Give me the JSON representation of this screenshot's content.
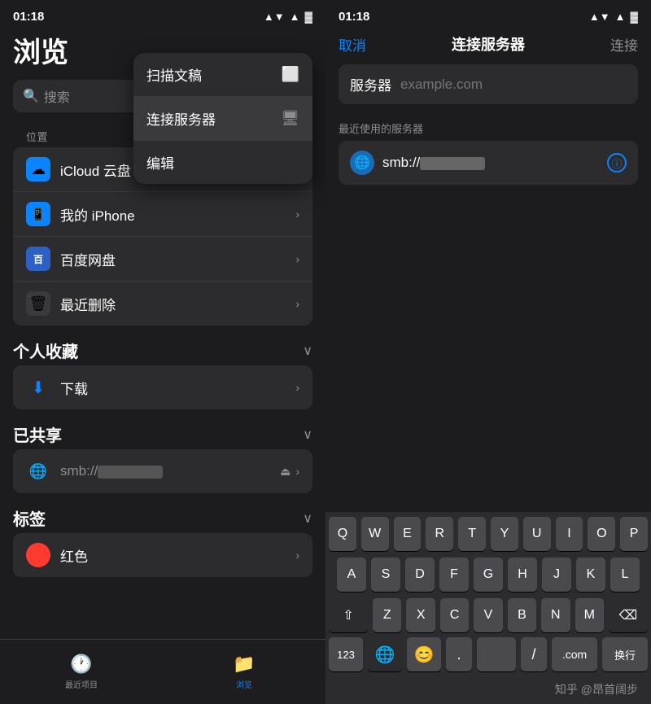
{
  "left": {
    "statusBar": {
      "time": "01:18",
      "icons": "▲ ▼ ● ■"
    },
    "title": "浏览",
    "moreBtn": "•••",
    "searchPlaceholder": "搜索",
    "locationLabel": "位置",
    "locationItems": [
      {
        "id": "icloud",
        "label": "iCloud 云盘",
        "iconColor": "#1a9af5",
        "iconEmoji": "☁"
      },
      {
        "id": "iphone",
        "label": "我的 iPhone",
        "iconColor": "#0a84ff",
        "iconEmoji": "📱"
      },
      {
        "id": "baidu",
        "label": "百度网盘",
        "iconColor": "#2d60c4",
        "iconEmoji": "🅱"
      },
      {
        "id": "trash",
        "label": "最近删除",
        "iconColor": "#3a3a3c",
        "iconEmoji": "🗑"
      }
    ],
    "favoritesLabel": "个人收藏",
    "favoritesItems": [
      {
        "id": "download",
        "label": "下载"
      }
    ],
    "sharedLabel": "已共享",
    "sharedItems": [
      {
        "id": "shared-smb",
        "label": "smb://[redacted]"
      }
    ],
    "tagsLabel": "标签",
    "tagsItems": [
      {
        "id": "red-tag",
        "label": "红色",
        "color": "#ff3b30"
      }
    ],
    "nav": {
      "recent": "最近项目",
      "browse": "浏览"
    },
    "dropdown": {
      "items": [
        {
          "id": "scan",
          "label": "扫描文稿",
          "icon": "⬜"
        },
        {
          "id": "connect",
          "label": "连接服务器",
          "icon": "🖥"
        },
        {
          "id": "edit",
          "label": "编辑",
          "icon": ""
        }
      ]
    }
  },
  "right": {
    "statusBar": {
      "time": "01:18"
    },
    "nav": {
      "cancel": "取消",
      "title": "连接服务器",
      "connect": "连接"
    },
    "serverLabel": "服务器",
    "serverPlaceholder": "example.com",
    "recentLabel": "最近使用的服务器",
    "recentServer": "smb://[redacted]",
    "keyboard": {
      "row1": [
        "Q",
        "W",
        "E",
        "R",
        "T",
        "Y",
        "U",
        "I",
        "O",
        "P"
      ],
      "row2": [
        "A",
        "S",
        "D",
        "F",
        "G",
        "H",
        "J",
        "K",
        "L"
      ],
      "row3": [
        "Z",
        "X",
        "C",
        "V",
        "B",
        "N",
        "M"
      ],
      "numLabel": "123",
      "dotLabel": ".",
      "slashLabel": "/",
      "dotcomLabel": ".com",
      "returnLabel": "换行",
      "emojiLabel": "😊"
    },
    "watermark": "知乎 @昂首阔步"
  }
}
